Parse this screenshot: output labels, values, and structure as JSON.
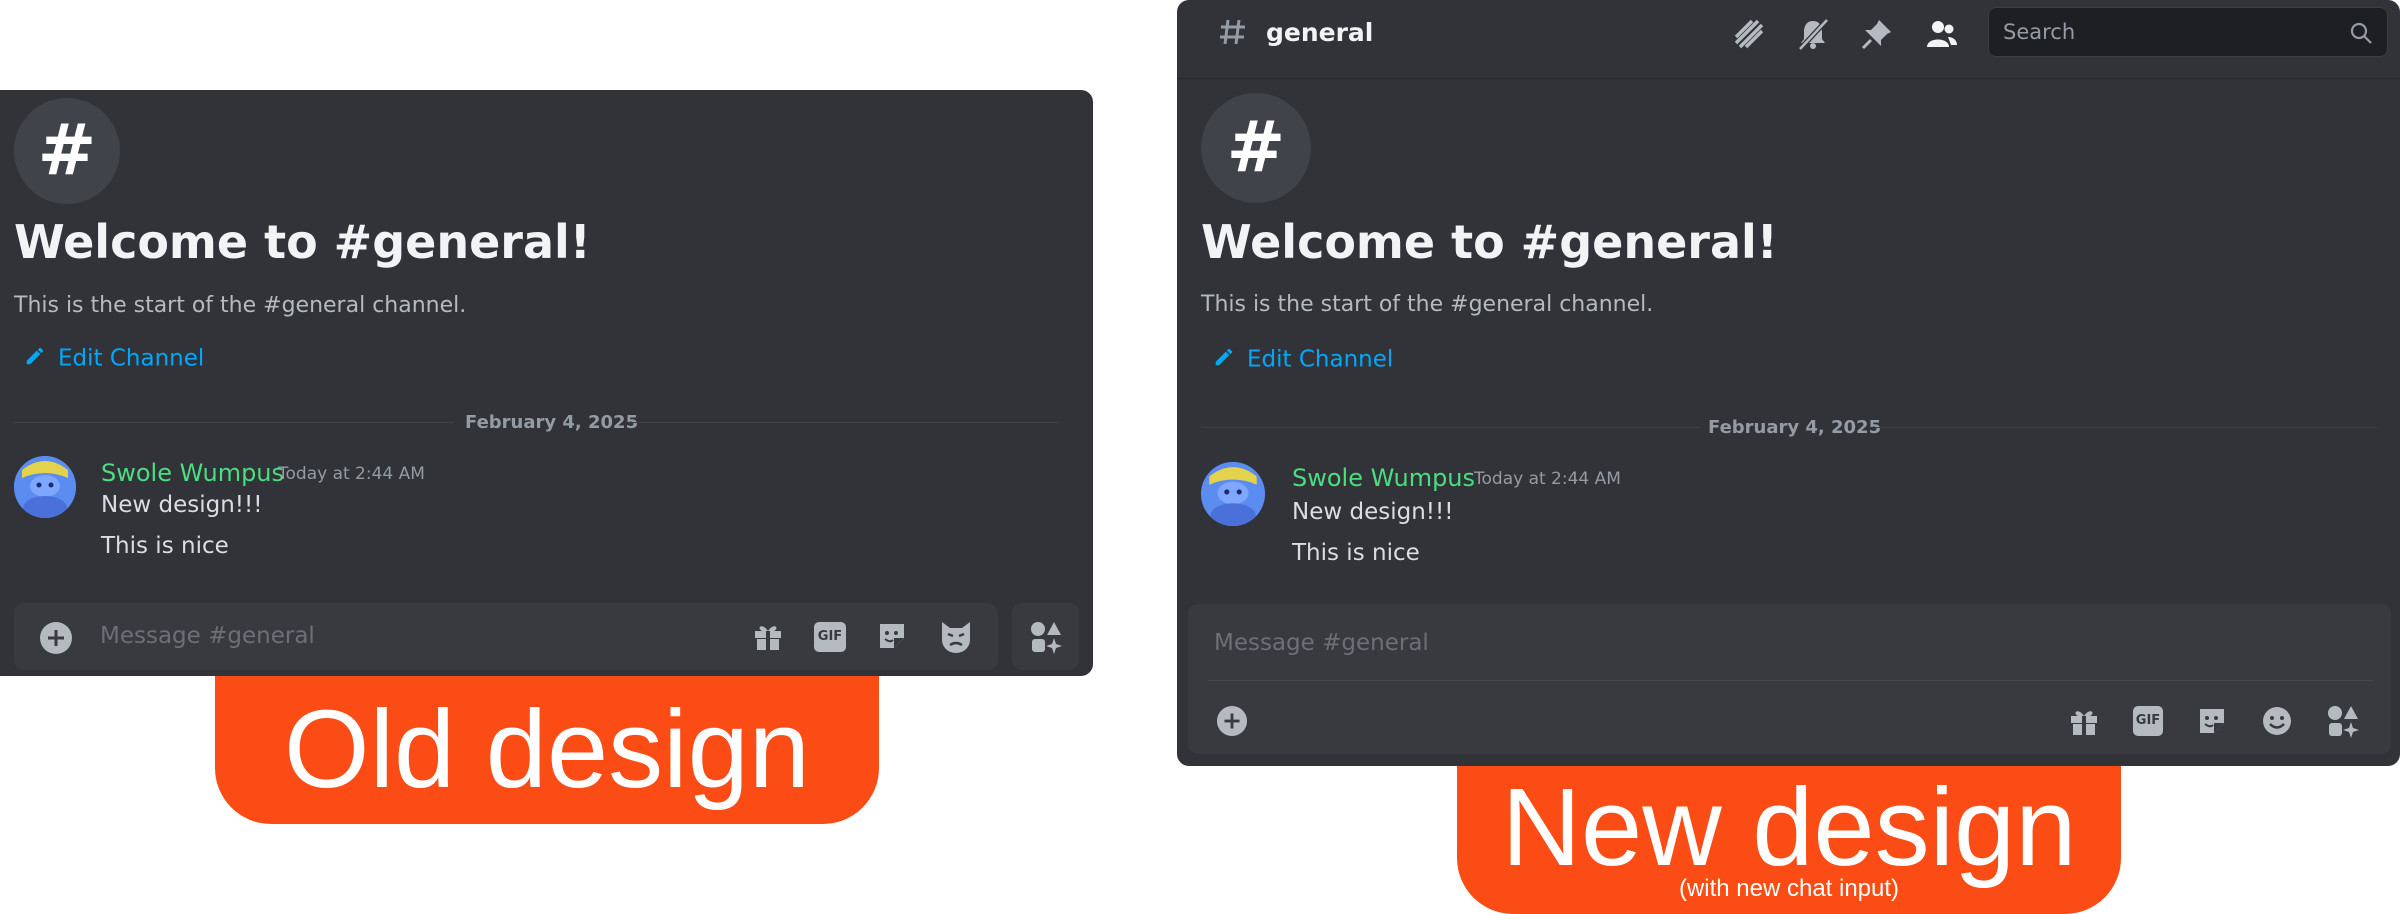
{
  "old": {
    "channel_symbol": "#",
    "welcome_title": "Welcome to #general!",
    "start_text": "This is the start of the #general channel.",
    "edit_channel": "Edit Channel",
    "date": "February 4, 2025",
    "message": {
      "author": "Swole Wumpus",
      "timestamp": "Today at 2:44 AM",
      "lines": [
        "New design!!!",
        "This is nice"
      ]
    },
    "input_placeholder": "Message #general",
    "gif_label": "GIF",
    "icons": [
      "add-circle-icon",
      "gift-icon",
      "gif-icon",
      "sticker-icon",
      "emoji-icon",
      "apps-icon"
    ],
    "badge": "Old design"
  },
  "new": {
    "channel_symbol": "#",
    "channel_name": "general",
    "search_placeholder": "Search",
    "header_icons": [
      "threads-icon",
      "mute-bell-icon",
      "pin-icon",
      "members-icon",
      "search-icon"
    ],
    "welcome_title": "Welcome to #general!",
    "start_text": "This is the start of the #general channel.",
    "edit_channel": "Edit Channel",
    "date": "February 4, 2025",
    "message": {
      "author": "Swole Wumpus",
      "timestamp": "Today at 2:44 AM",
      "lines": [
        "New design!!!",
        "This is nice"
      ]
    },
    "input_placeholder": "Message #general",
    "gif_label": "GIF",
    "icons": [
      "add-circle-icon",
      "gift-icon",
      "gif-icon",
      "sticker-icon",
      "emoji-icon",
      "apps-icon"
    ],
    "badge": "New design",
    "badge_sub": "(with new chat input)"
  },
  "colors": {
    "panel_bg": "#313338",
    "input_bg": "#383a40",
    "author": "#4ade80",
    "link": "#00a8fc",
    "badge": "#fc4c16"
  }
}
